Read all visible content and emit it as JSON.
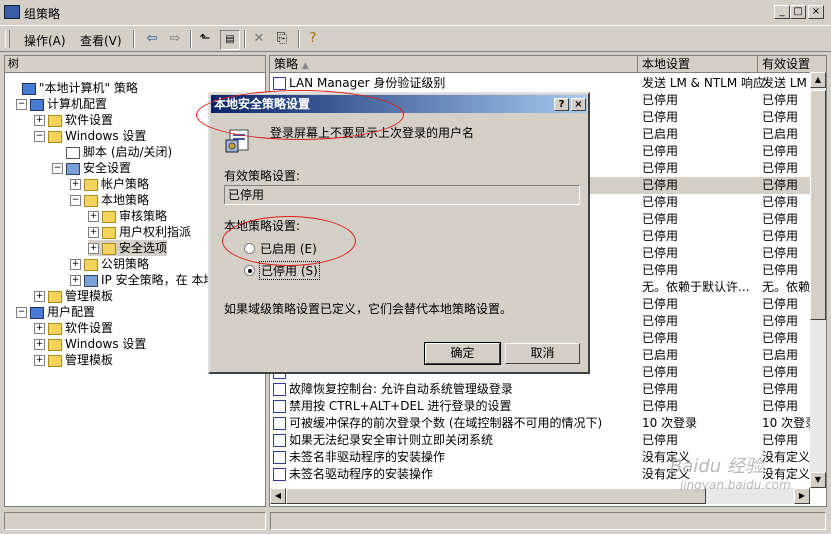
{
  "window": {
    "title": "组策略",
    "min": "_",
    "max": "□",
    "close": "×"
  },
  "menu": {
    "action": "操作(A)",
    "view": "查看(V)"
  },
  "tree": {
    "header": "树",
    "items": [
      {
        "label": "\"本地计算机\" 策略",
        "icon": "policy-icon",
        "exp": ""
      },
      {
        "label": "计算机配置",
        "icon": "computer-icon",
        "exp": "−"
      },
      {
        "label": "软件设置",
        "icon": "folder-icon",
        "exp": "+"
      },
      {
        "label": "Windows 设置",
        "icon": "folder-icon",
        "exp": "−"
      },
      {
        "label": "脚本 (启动/关闭)",
        "icon": "script-icon",
        "exp": ""
      },
      {
        "label": "安全设置",
        "icon": "shield-icon",
        "exp": "−"
      },
      {
        "label": "帐户策略",
        "icon": "folder-icon",
        "exp": "+"
      },
      {
        "label": "本地策略",
        "icon": "folder-icon",
        "exp": "−"
      },
      {
        "label": "审核策略",
        "icon": "folder-icon",
        "exp": "+"
      },
      {
        "label": "用户权利指派",
        "icon": "folder-icon",
        "exp": "+"
      },
      {
        "label": "安全选项",
        "icon": "folder-icon",
        "exp": "+"
      },
      {
        "label": "公钥策略",
        "icon": "folder-icon",
        "exp": "+"
      },
      {
        "label": "IP 安全策略，在 本地",
        "icon": "ipsec-icon",
        "exp": "+"
      },
      {
        "label": "管理模板",
        "icon": "folder-icon",
        "exp": "+"
      },
      {
        "label": "用户配置",
        "icon": "user-icon",
        "exp": "−"
      },
      {
        "label": "软件设置",
        "icon": "folder-icon",
        "exp": "+"
      },
      {
        "label": "Windows 设置",
        "icon": "folder-icon",
        "exp": "+"
      },
      {
        "label": "管理模板",
        "icon": "folder-icon",
        "exp": "+"
      }
    ]
  },
  "list": {
    "columns": [
      "策略",
      "本地设置",
      "有效设置"
    ],
    "rows": [
      {
        "policy": "LAN Manager 身份验证级别",
        "local": "发送 LM & NTLM 响应",
        "effective": "发送 LM &"
      },
      {
        "policy": "",
        "local": "已停用",
        "effective": "已停用"
      },
      {
        "policy": "",
        "local": "已停用",
        "effective": "已停用"
      },
      {
        "policy": "",
        "local": "已启用",
        "effective": "已启用"
      },
      {
        "policy": "",
        "local": "已停用",
        "effective": "已停用"
      },
      {
        "policy": "",
        "local": "已停用",
        "effective": "已停用"
      },
      {
        "policy": "",
        "local": "已停用",
        "effective": "已停用"
      },
      {
        "policy": "",
        "local": "已停用",
        "effective": "已停用"
      },
      {
        "policy": "",
        "local": "已停用",
        "effective": "已停用"
      },
      {
        "policy": "",
        "local": "已停用",
        "effective": "已停用"
      },
      {
        "policy": "",
        "local": "已停用",
        "effective": "已停用"
      },
      {
        "policy": "",
        "local": "已停用",
        "effective": "已停用"
      },
      {
        "policy": "",
        "local": "无。依赖于默认许...",
        "effective": "无。依赖"
      },
      {
        "policy": "",
        "local": "已停用",
        "effective": "已停用"
      },
      {
        "policy": "",
        "local": "已停用",
        "effective": "已停用"
      },
      {
        "policy": "",
        "local": "已停用",
        "effective": "已停用"
      },
      {
        "policy": "",
        "local": "已启用",
        "effective": "已启用"
      },
      {
        "policy": "",
        "local": "已停用",
        "effective": "已停用"
      },
      {
        "policy": "故障恢复控制台: 允许自动系统管理级登录",
        "local": "已停用",
        "effective": "已停用"
      },
      {
        "policy": "禁用按 CTRL+ALT+DEL 进行登录的设置",
        "local": "已停用",
        "effective": "已停用"
      },
      {
        "policy": "可被缓冲保存的前次登录个数 (在域控制器不可用的情况下)",
        "local": "10 次登录",
        "effective": "10 次登录"
      },
      {
        "policy": "如果无法纪录安全审计则立即关闭系统",
        "local": "已停用",
        "effective": "已停用"
      },
      {
        "policy": "未签名非驱动程序的安装操作",
        "local": "没有定义",
        "effective": "没有定义"
      },
      {
        "policy": "未签名驱动程序的安装操作",
        "local": "没有定义",
        "effective": "没有定义"
      }
    ]
  },
  "dialog": {
    "title": "本地安全策略设置",
    "help": "?",
    "close": "×",
    "policy_name": "登录屏幕上不要显示上次登录的用户名",
    "effective_label": "有效策略设置:",
    "effective_value": "已停用",
    "local_label": "本地策略设置:",
    "enabled_label": "已启用 (E)",
    "disabled_label": "已停用 (S)",
    "selected": "disabled",
    "note": "如果域级策略设置已定义，它们会替代本地策略设置。",
    "ok": "确定",
    "cancel": "取消"
  },
  "watermark": {
    "line1": "Baidu 经验",
    "line2": "jingyan.baidu.com"
  }
}
